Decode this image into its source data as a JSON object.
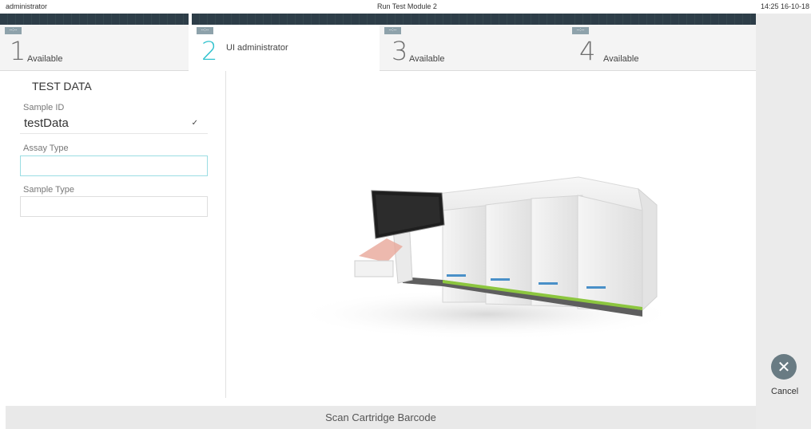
{
  "topbar": {
    "user": "administrator",
    "title": "Run Test Module 2",
    "datetime": "14:25 16-10-18"
  },
  "modules": [
    {
      "chip": "--:--",
      "number": "1",
      "label": "Available",
      "active": false
    },
    {
      "chip": "--:--",
      "number": "2",
      "label": "UI administrator",
      "active": true
    },
    {
      "chip": "--:--",
      "number": "3",
      "label": "Available",
      "active": false
    },
    {
      "chip": "--:--",
      "number": "4",
      "label": "Available",
      "active": false
    }
  ],
  "test_data": {
    "title": "TEST DATA",
    "sample_id_label": "Sample ID",
    "sample_id_value": "testData",
    "assay_type_label": "Assay Type",
    "assay_type_value": "",
    "sample_type_label": "Sample Type",
    "sample_type_value": ""
  },
  "bottom": {
    "message": "Scan Cartridge Barcode"
  },
  "cancel": {
    "label": "Cancel",
    "icon": "close-icon"
  },
  "colors": {
    "accent": "#32c2ce",
    "tab_strip": "#2d3d48",
    "cancel_button": "#697b83"
  }
}
